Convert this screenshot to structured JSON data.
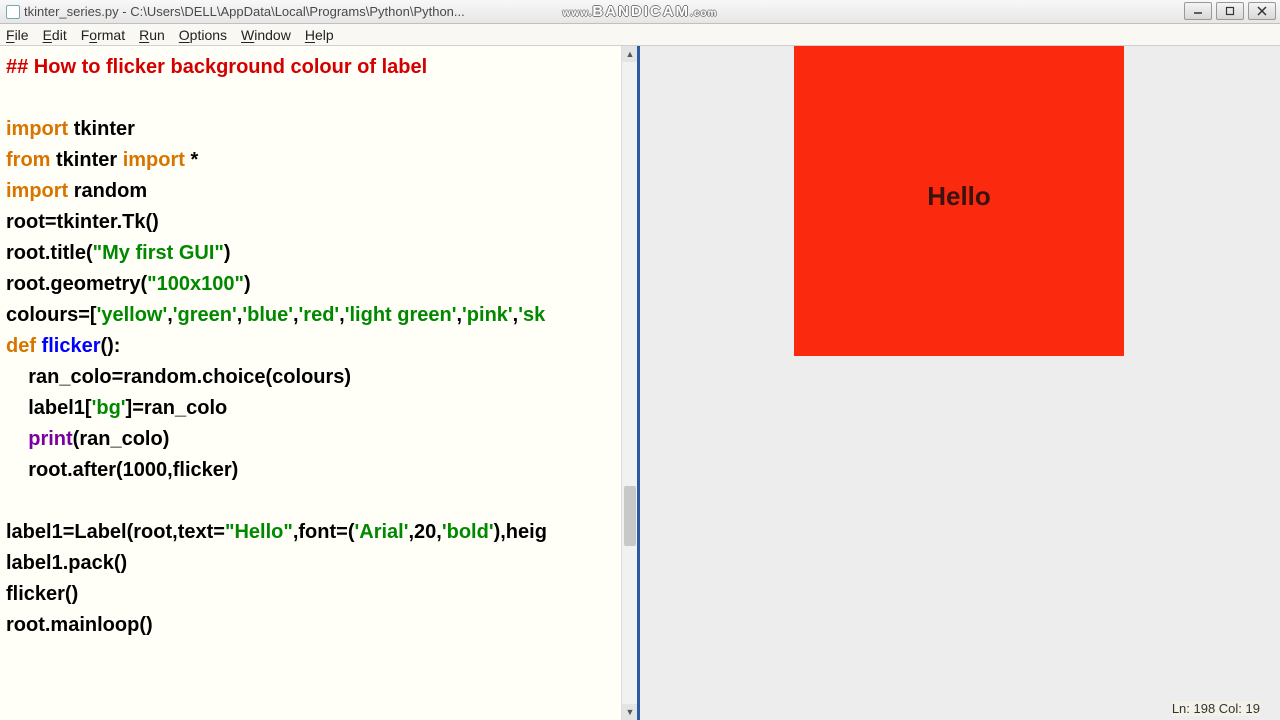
{
  "titlebar": {
    "title": "tkinter_series.py - C:\\Users\\DELL\\AppData\\Local\\Programs\\Python\\Python...",
    "watermark_pre": "www.",
    "watermark": "BANDICAM",
    "watermark_post": ".com"
  },
  "menu": {
    "file": "File",
    "edit": "Edit",
    "format": "Format",
    "run": "Run",
    "options": "Options",
    "window": "Window",
    "help": "Help"
  },
  "code": {
    "l1": "## How to flicker background colour of label",
    "l3a": "import",
    "l3b": " tkinter",
    "l4a": "from",
    "l4b": " tkinter ",
    "l4c": "import",
    "l4d": " *",
    "l5a": "import",
    "l5b": " random",
    "l6": "root=tkinter.Tk()",
    "l7a": "root.title(",
    "l7b": "\"My first GUI\"",
    "l7c": ")",
    "l8a": "root.geometry(",
    "l8b": "\"100x100\"",
    "l8c": ")",
    "l9a": "colours=[",
    "l9b": "'yellow'",
    "l9c": ",",
    "l9d": "'green'",
    "l9e": ",",
    "l9f": "'blue'",
    "l9g": ",",
    "l9h": "'red'",
    "l9i": ",",
    "l9j": "'light green'",
    "l9k": ",",
    "l9l": "'pink'",
    "l9m": ",",
    "l9n": "'sk",
    "l10a": "def",
    "l10b": " flicker",
    "l10c": "():",
    "l11": "    ran_colo=random.choice(colours)",
    "l12a": "    label1[",
    "l12b": "'bg'",
    "l12c": "]=ran_colo",
    "l13a": "    ",
    "l13b": "print",
    "l13c": "(ran_colo)",
    "l14a": "    root.after(",
    "l14b": "1000",
    "l14c": ",flicker)",
    "l16a": "label1=Label(root,text=",
    "l16b": "\"Hello\"",
    "l16c": ",font=(",
    "l16d": "'Arial'",
    "l16e": ",",
    "l16f": "20",
    "l16g": ",",
    "l16h": "'bold'",
    "l16i": "),heig",
    "l17": "label1.pack()",
    "l18": "flicker()",
    "l19": "root.mainloop()"
  },
  "tk": {
    "label_text": "Hello",
    "bg": "#fb2a0f"
  },
  "status": {
    "text": "Ln: 198  Col: 19"
  }
}
